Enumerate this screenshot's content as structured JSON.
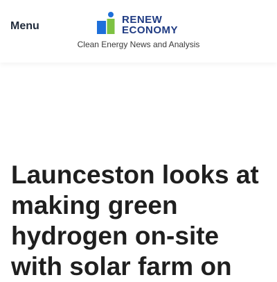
{
  "header": {
    "menu_label": "Menu",
    "logo": {
      "line1": "RENEW",
      "line2": "ECONOMY",
      "icon": "renew-economy-logo-icon",
      "colors": {
        "blue": "#1e6fd9",
        "green": "#7ec242",
        "dark_blue": "#1e3a82"
      }
    },
    "tagline": "Clean Energy News and Analysis"
  },
  "article": {
    "title": "Launceston looks at making green hydrogen on-site with solar farm on"
  }
}
